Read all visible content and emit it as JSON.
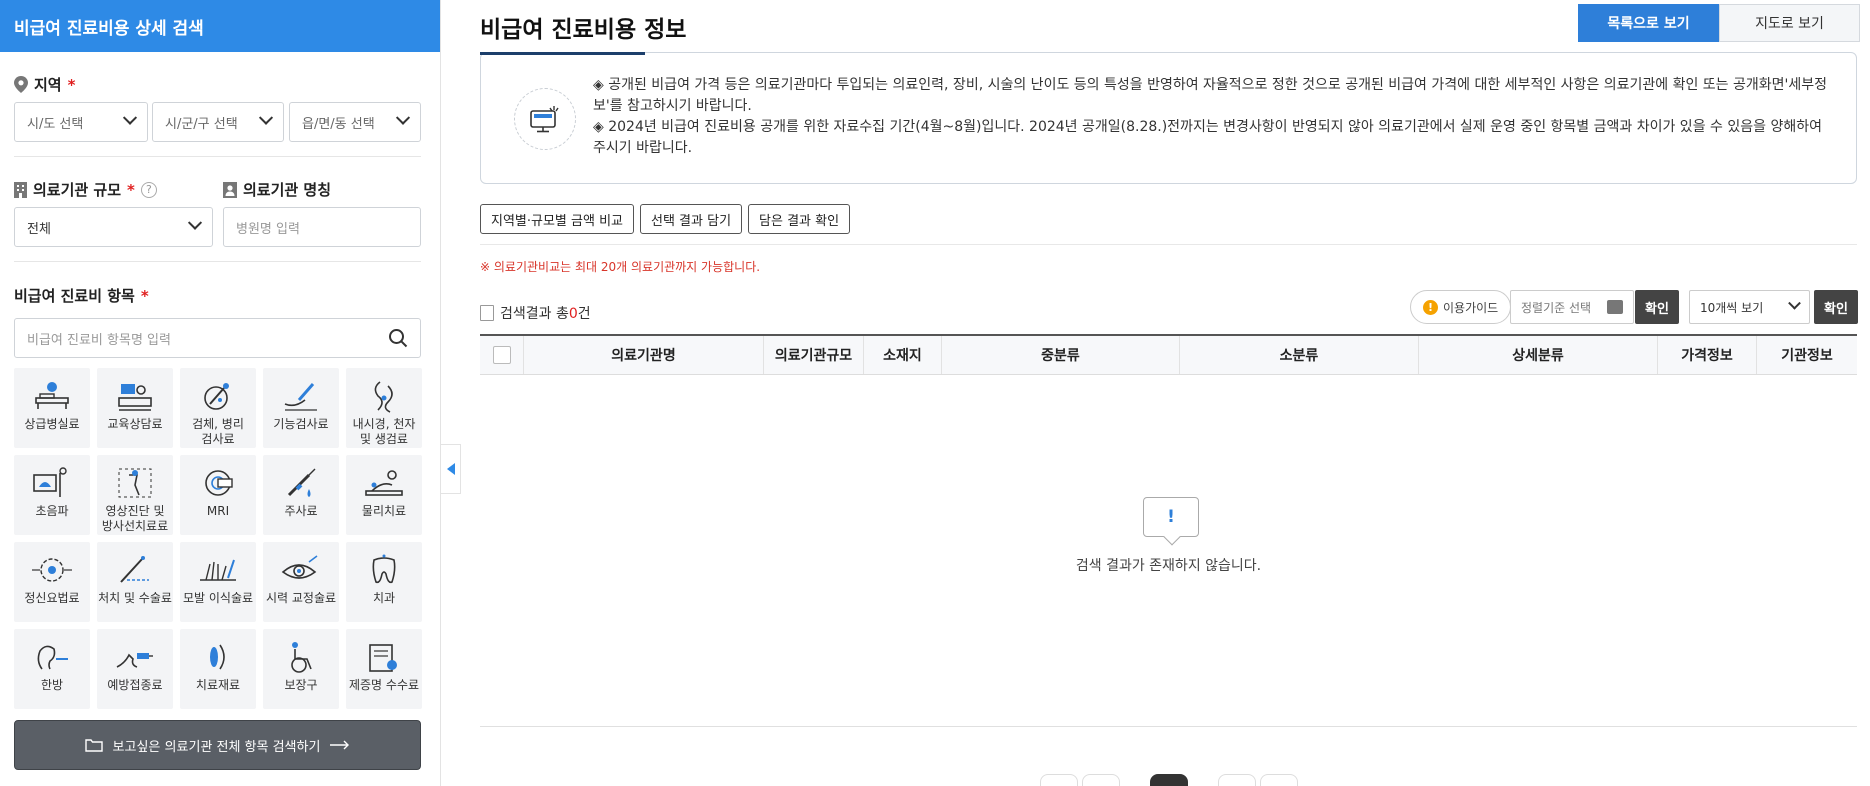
{
  "left": {
    "header": "비급여 진료비용 상세 검색",
    "region": {
      "label": "지역",
      "sido": "시/도 선택",
      "sigungu": "시/군/구 선택",
      "dong": "읍/면/동 선택"
    },
    "scale": {
      "label": "의료기관 규모",
      "value": "전체",
      "help": "?"
    },
    "name": {
      "label": "의료기관 명칭",
      "placeholder": "병원명 입력"
    },
    "item": {
      "label": "비급여 진료비 항목",
      "placeholder": "비급여 진료비 항목명 입력"
    },
    "required_mark": "*",
    "categories": [
      {
        "label": "상급병실료",
        "icon": "hospital-bed-icon"
      },
      {
        "label": "교육상담료",
        "icon": "counseling-icon"
      },
      {
        "label": "검체, 병리\n검사료",
        "icon": "microscope-icon"
      },
      {
        "label": "기능검사료",
        "icon": "function-test-icon"
      },
      {
        "label": "내시경, 천자\n및 생검료",
        "icon": "endoscope-icon"
      },
      {
        "label": "초음파",
        "icon": "ultrasound-icon"
      },
      {
        "label": "영상진단 및\n방사선치료료",
        "icon": "radiology-icon"
      },
      {
        "label": "MRI",
        "icon": "mri-icon"
      },
      {
        "label": "주사료",
        "icon": "syringe-icon"
      },
      {
        "label": "물리치료",
        "icon": "physical-therapy-icon"
      },
      {
        "label": "정신요법료",
        "icon": "brain-icon"
      },
      {
        "label": "처치 및 수술료",
        "icon": "surgery-icon"
      },
      {
        "label": "모발 이식술료",
        "icon": "hair-transplant-icon"
      },
      {
        "label": "시력 교정술료",
        "icon": "eye-icon"
      },
      {
        "label": "치과",
        "icon": "tooth-icon"
      },
      {
        "label": "한방",
        "icon": "acupuncture-icon"
      },
      {
        "label": "예방접종료",
        "icon": "vaccine-icon"
      },
      {
        "label": "치료재료",
        "icon": "treatment-material-icon"
      },
      {
        "label": "보장구",
        "icon": "wheelchair-icon"
      },
      {
        "label": "제증명 수수료",
        "icon": "certificate-icon"
      }
    ],
    "search_all_button": "보고싶은 의료기관 전체 항목 검색하기"
  },
  "main": {
    "title": "비급여 진료비용 정보",
    "view_list": "목록으로 보기",
    "view_map": "지도로 보기",
    "notice_1": "◈ 공개된 비급여 가격 등은 의료기관마다 투입되는 의료인력, 장비, 시술의 난이도 등의 특성을 반영하여 자율적으로 정한 것으로 공개된 비급여 가격에 대한 세부적인 사항은 의료기관에 확인 또는 공개화면'세부정보'를 참고하시기 바랍니다.",
    "notice_2": "◈ 2024년 비급여 진료비용 공개를 위한 자료수집 기간(4월~8월)입니다. 2024년 공개일(8.28.)전까지는 변경사항이 반영되지 않아 의료기관에서 실제 운영 중인 항목별 금액과 차이가 있을 수 있음을 양해하여 주시기 바랍니다.",
    "btn_compare": "지역별·규모별 금액 비교",
    "btn_add": "선택 결과 담기",
    "btn_check": "담은 결과 확인",
    "warning": "※ 의료기관비교는 최대 20개 의료기관까지 가능합니다.",
    "result_prefix": "검색결과 총",
    "result_count": "0",
    "result_suffix": "건",
    "guide": "이용가이드",
    "guide_mark": "!",
    "sort_placeholder": "정렬기준 선택",
    "confirm": "확인",
    "per_page": "10개씩 보기",
    "columns": [
      "의료기관명",
      "의료기관규모",
      "소재지",
      "중분류",
      "소분류",
      "상세분류",
      "가격정보",
      "기관정보"
    ],
    "empty_mark": "!",
    "empty_text": "검색 결과가 존재하지 않습니다."
  },
  "colors": {
    "accent": "#2e8ae6",
    "dark_button": "#444444",
    "required": "#e02020"
  }
}
